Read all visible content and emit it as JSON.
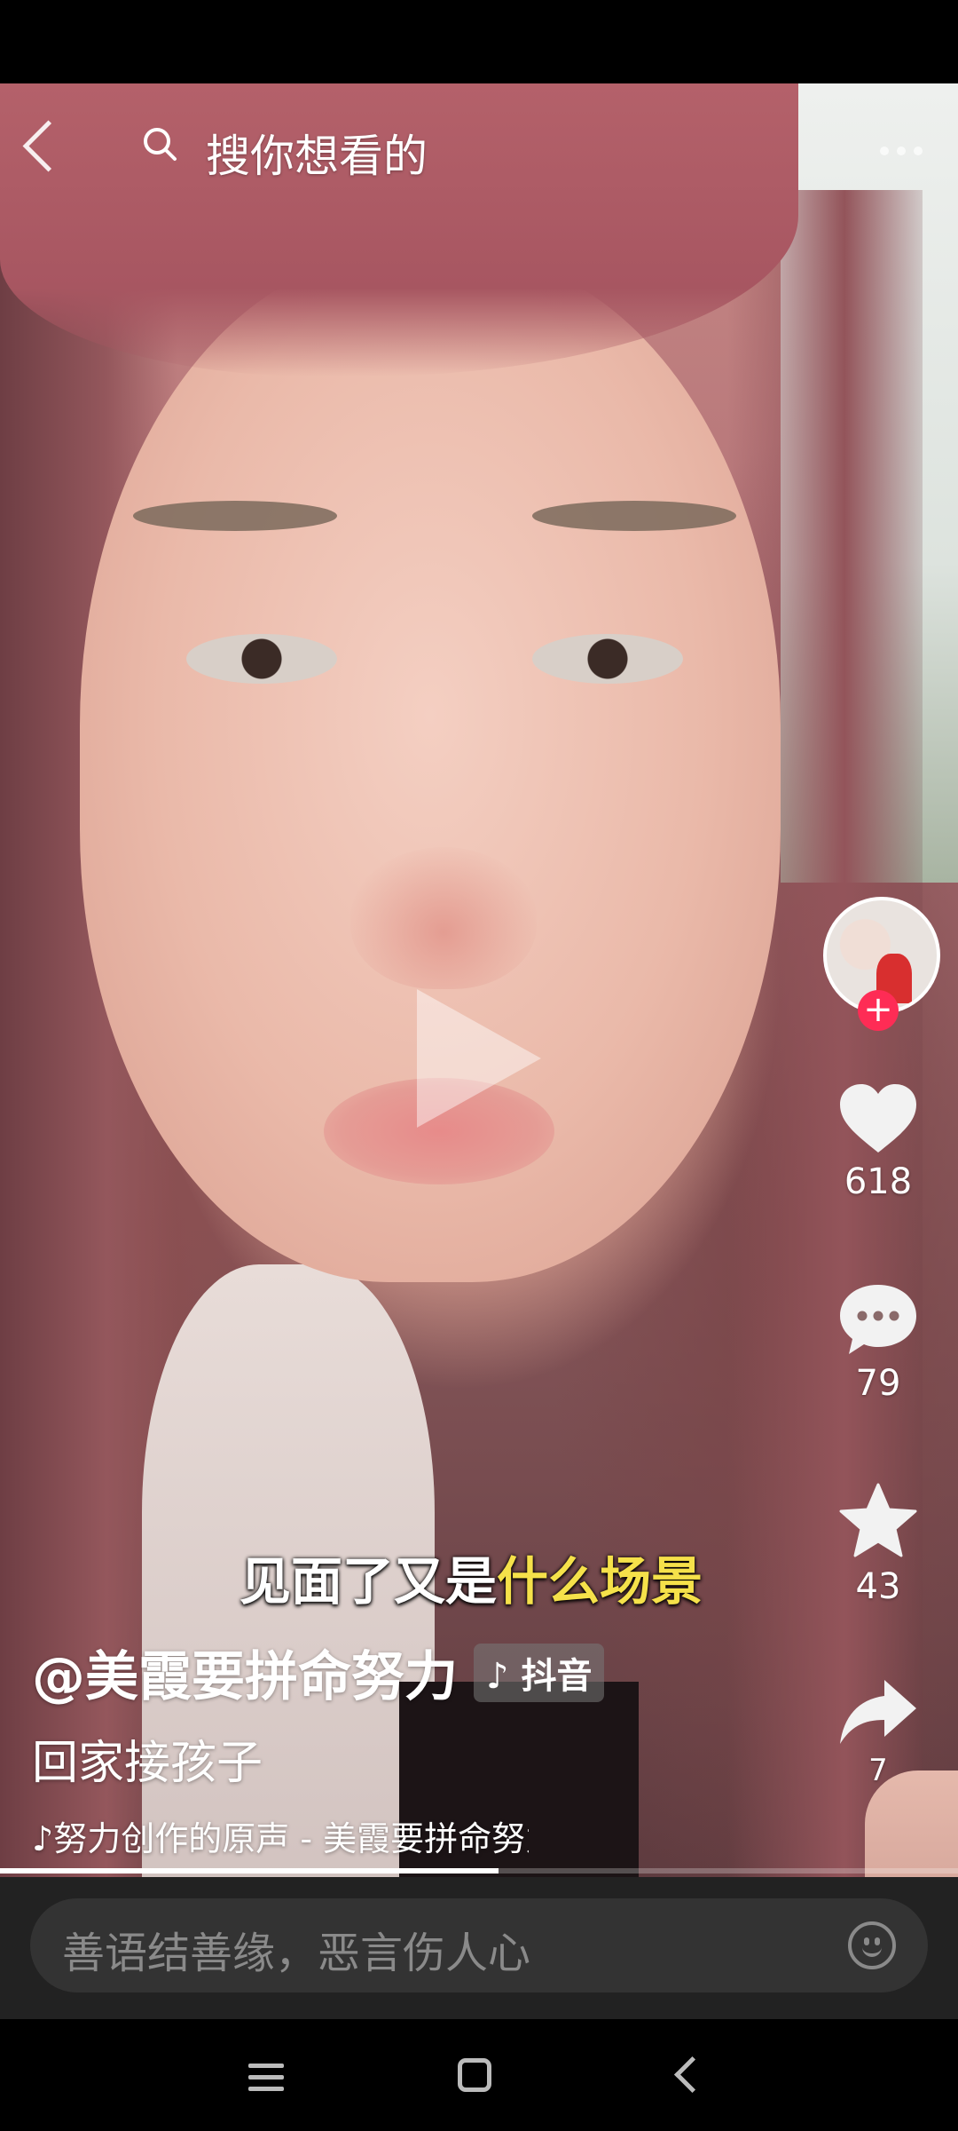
{
  "search": {
    "placeholder_text": "搜你想看的"
  },
  "caption": {
    "part_white": "见面了又是",
    "part_yellow": "什么场景"
  },
  "rail": {
    "likes": "618",
    "comments": "79",
    "favorites": "43",
    "shares": "7"
  },
  "video": {
    "author": "@美霞要拼命努力",
    "platform_tag": "抖音",
    "description": "回家接孩子",
    "music": "努力创作的原声 - 美霞要拼命努力",
    "progress": 0.52
  },
  "comment": {
    "placeholder": "善语结善缘，恶言伤人心"
  },
  "icons": {
    "back": "back-chevron-icon",
    "search": "search-icon",
    "more": "more-dots-icon",
    "play": "play-icon",
    "like": "heart-icon",
    "comment": "comment-bubble-icon",
    "favorite": "star-icon",
    "share": "share-arrow-icon",
    "emoji": "emoji-icon",
    "music": "music-note-icon"
  },
  "colors": {
    "follow": "#fe2c55",
    "caption_highlight": "#f5e14a"
  }
}
